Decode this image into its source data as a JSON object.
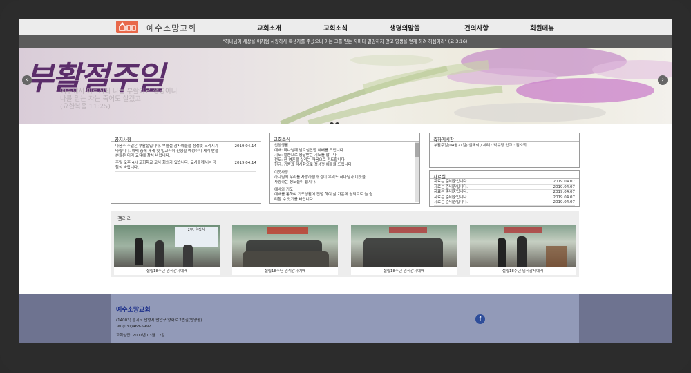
{
  "site": {
    "name": "예수소망교회"
  },
  "nav": {
    "items": [
      {
        "label": "교회소개"
      },
      {
        "label": "교회소식"
      },
      {
        "label": "생명의말씀"
      },
      {
        "label": "건의사항"
      },
      {
        "label": "회원메뉴"
      }
    ]
  },
  "verse": "\"하나님이 세상을 이처럼 사랑하사 독생자를 주셨으니 이는 그를 믿는 자마다 멸망하지 않고 영생을 얻게 하려 하심이라\" (요 3:16)",
  "banner": {
    "title": "부활절주일",
    "subtitle_line1": "예수께서 이르시되 나는 부활이요 생명이니",
    "subtitle_line2": "나를 믿는 자는 죽어도 살겠고",
    "subtitle_line3": "(요한복음 11:25)"
  },
  "notices": {
    "title": "공지사항",
    "items": [
      {
        "text": "다음주 주일은 부활절입니다. 부활절 감사예물을 정성껏 드리시기 바랍니다. 예배 중에 세례 및 입교식이 진행될 예정이니 세례 받을 분들은 미리 교육에 참석 바랍니다.",
        "date": "2019.04.14"
      },
      {
        "text": "주일 오후 4시 교회학교 교사 회의가 있습니다. 교사들께서는 꼭 참석 바랍니다.",
        "date": "2019.04.14"
      }
    ]
  },
  "church_news": {
    "title": "교회소식",
    "sections": [
      {
        "heading": "신앙생활",
        "lines": [
          "예배: 하나님께 받으실만한 예배를 드립니다.",
          "기도: 말씀으로 응답받는 기도를 합니다.",
          "전도: 한 영혼을 살리는 마음으로 전도합니다.",
          "헌금: 기쁨과 감사함으로 정성껏 예물을 드립니다."
        ]
      },
      {
        "heading": "이웃사랑",
        "lines": [
          "하나님께 우리를 사랑하심과 같이 우리도 하나님과 이웃을",
          "사랑하는 성도들이 됩시다."
        ]
      },
      {
        "heading": "예배와 기도",
        "lines": [
          "예배를 통하여 기도생활에 전념 하여 삶 가운데 영적으로 늘 승",
          "리할 수 있기를 바랍니다."
        ]
      }
    ]
  },
  "congrats": {
    "title": "축하게시판",
    "text": "부활주일(04월21일) 설레식 / 세례 : 박수정 입교 : 김소희"
  },
  "archive": {
    "title": "자료실",
    "items": [
      {
        "text": "자료는 준비중입니다.",
        "date": "2019.04.07"
      },
      {
        "text": "자료는 준비중입니다.",
        "date": "2019.04.07"
      },
      {
        "text": "자료는 준비중입니다.",
        "date": "2019.04.07"
      },
      {
        "text": "자료는 준비중입니다.",
        "date": "2019.04.07"
      },
      {
        "text": "자료는 준비중입니다.",
        "date": "2019.04.07"
      }
    ]
  },
  "gallery": {
    "title": "갤러리",
    "items": [
      {
        "caption": "설립18주년 임직감사예배",
        "banner_text": "2부. 임직식"
      },
      {
        "caption": "설립18주년 임직감사예배"
      },
      {
        "caption": "설립18주년 임직감사예배"
      },
      {
        "caption": "설립18주년 임직감사예배"
      }
    ]
  },
  "footer": {
    "name": "예수소망교회",
    "address": "(14003) 경기도 안양시 만안구 양화로 2번길(안양동)",
    "tel": "Tel:(031)468-5992",
    "founded": "교회설립: 2001년 03월 17일",
    "facebook": "f"
  },
  "colors": {
    "accent": "#e8684a",
    "footer_bg": "#929ab8",
    "footer_title": "#1c2f8a"
  }
}
